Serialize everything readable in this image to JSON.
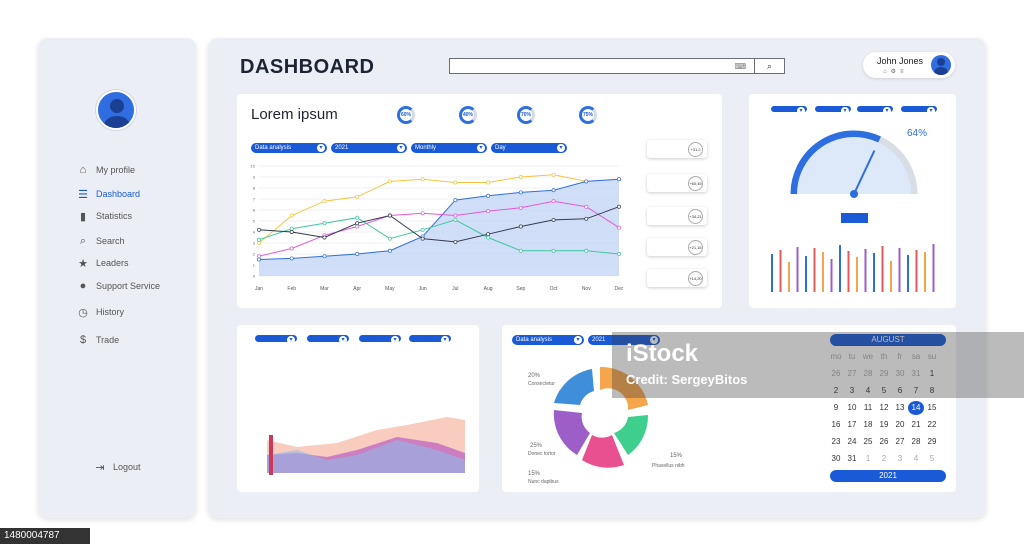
{
  "sidebar": {
    "items": [
      {
        "label": "My profile",
        "icon": "home-icon"
      },
      {
        "label": "Dashboard",
        "icon": "list-icon"
      },
      {
        "label": "Statistics",
        "icon": "bar-chart-icon"
      },
      {
        "label": "Search",
        "icon": "search-icon"
      },
      {
        "label": "Leaders",
        "icon": "star-icon"
      },
      {
        "label": "Support Service",
        "icon": "chat-icon"
      },
      {
        "label": "History",
        "icon": "clock-icon"
      },
      {
        "label": "Trade",
        "icon": "dollar-icon"
      }
    ],
    "logout": "Logout"
  },
  "header": {
    "title": "DASHBOARD",
    "user_name": "John Jones"
  },
  "main_card": {
    "title": "Lorem ipsum",
    "rings": [
      "60%",
      "40%",
      "70%",
      "75%"
    ],
    "filters": [
      "Data analysis",
      "2021",
      "Monthly",
      "Day"
    ],
    "months": [
      "Jan",
      "Feb",
      "Mar",
      "Apr",
      "May",
      "Jun",
      "Jul",
      "Aug",
      "Sep",
      "Oct",
      "Nov",
      "Dec"
    ],
    "stats": [
      "+31,2",
      "+60,45",
      "+34,21",
      "+21,15",
      "+14,20"
    ]
  },
  "gauge_card": {
    "filters": [
      "Data analysis",
      "2021",
      "Monthly",
      "Day"
    ],
    "value": "64%",
    "gauge_fraction": 0.64
  },
  "area_card": {
    "filters": [
      "Data analysis",
      "2021",
      "Monthly",
      "Day"
    ]
  },
  "pie_card": {
    "filters": [
      "Data analysis",
      "2021",
      "Monthly",
      "Day"
    ],
    "labels": [
      "20%",
      "25%",
      "15%",
      "15%",
      "25%"
    ],
    "names": [
      "Consectetur",
      "Donec tortor",
      "Nunc dapibus",
      "Phasellus nibh"
    ]
  },
  "watermark": {
    "title": "iStock",
    "credit": "Credit: SergeyBitos"
  },
  "image_id": "1480004787",
  "calendar": {
    "month": "AUGUST",
    "year": "2021",
    "weekdays": [
      "mo",
      "tu",
      "we",
      "th",
      "fr",
      "sa",
      "su"
    ],
    "days": [
      "26",
      "27",
      "28",
      "29",
      "30",
      "31",
      "1",
      "2",
      "3",
      "4",
      "5",
      "6",
      "7",
      "8",
      "9",
      "10",
      "11",
      "12",
      "13",
      "14",
      "15",
      "16",
      "17",
      "18",
      "19",
      "20",
      "21",
      "22",
      "23",
      "24",
      "25",
      "26",
      "27",
      "28",
      "29",
      "30",
      "31",
      "1",
      "2",
      "3",
      "4",
      "5"
    ],
    "selected": "14"
  },
  "chart_data": {
    "type": "line",
    "categories": [
      "Jan",
      "Feb",
      "Mar",
      "Apr",
      "May",
      "Jun",
      "Jul",
      "Aug",
      "Sep",
      "Oct",
      "Nov",
      "Dec"
    ],
    "ylim": [
      0,
      10
    ],
    "yticks": [
      0,
      1,
      2,
      3,
      4,
      5,
      6,
      7,
      8,
      9,
      10
    ],
    "series": [
      {
        "color": "#f5c542",
        "values": [
          3,
          5.5,
          6.8,
          7.2,
          8.6,
          8.8,
          8.5,
          8.5,
          9,
          9.2,
          8.6,
          8.8
        ]
      },
      {
        "color": "#2d6fe0",
        "values": [
          1.5,
          1.6,
          1.8,
          2,
          2.3,
          3.6,
          6.9,
          7.3,
          7.6,
          7.8,
          8.6,
          8.8
        ]
      },
      {
        "color": "#e35ad6",
        "values": [
          1.8,
          2.5,
          3.7,
          4.5,
          5.5,
          5.7,
          5.5,
          5.9,
          6.2,
          6.8,
          6.3,
          4.4
        ]
      },
      {
        "color": "#3ec7a2",
        "values": [
          3.3,
          4.3,
          4.8,
          5.3,
          3.4,
          4.2,
          5.1,
          3.5,
          2.3,
          2.3,
          2.3,
          2
        ]
      },
      {
        "color": "#333a50",
        "values": [
          4.2,
          4.0,
          3.5,
          4.8,
          5.5,
          3.4,
          3.1,
          3.8,
          4.5,
          5.1,
          5.2,
          6.3
        ]
      }
    ]
  }
}
